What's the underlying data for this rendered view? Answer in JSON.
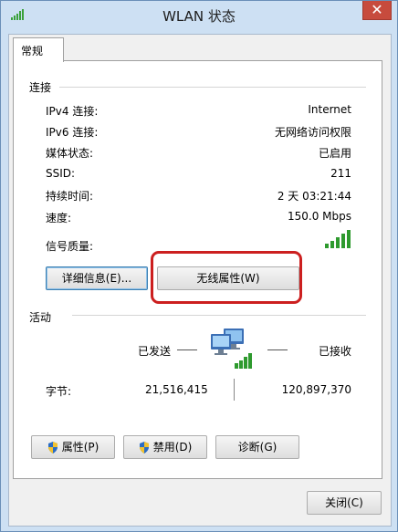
{
  "window": {
    "title": "WLAN 状态",
    "close_label": "✕"
  },
  "tabs": [
    {
      "label": "常规"
    }
  ],
  "connection": {
    "group_label": "连接",
    "rows": [
      {
        "label": "IPv4 连接:",
        "value": "Internet"
      },
      {
        "label": "IPv6 连接:",
        "value": "无网络访问权限"
      },
      {
        "label": "媒体状态:",
        "value": "已启用"
      },
      {
        "label": "SSID:",
        "value": "211"
      },
      {
        "label": "持续时间:",
        "value": "2 天 03:21:44"
      },
      {
        "label": "速度:",
        "value": "150.0 Mbps"
      }
    ],
    "signal_label": "信号质量:",
    "signal_bars": 5,
    "signal_color": "#2e9a2e",
    "details_button": "详细信息(E)...",
    "wireless_button": "无线属性(W)"
  },
  "activity": {
    "group_label": "活动",
    "sent_label": "已发送",
    "received_label": "已接收",
    "bytes_label": "字节:",
    "bytes_sent": "21,516,415",
    "bytes_received": "120,897,370"
  },
  "actions": {
    "properties_button": "属性(P)",
    "disable_button": "禁用(D)",
    "diagnose_button": "诊断(G)"
  },
  "footer": {
    "close_button": "关闭(C)"
  },
  "colors": {
    "highlight": "#cc1f1f",
    "close": "#c74b3d"
  }
}
